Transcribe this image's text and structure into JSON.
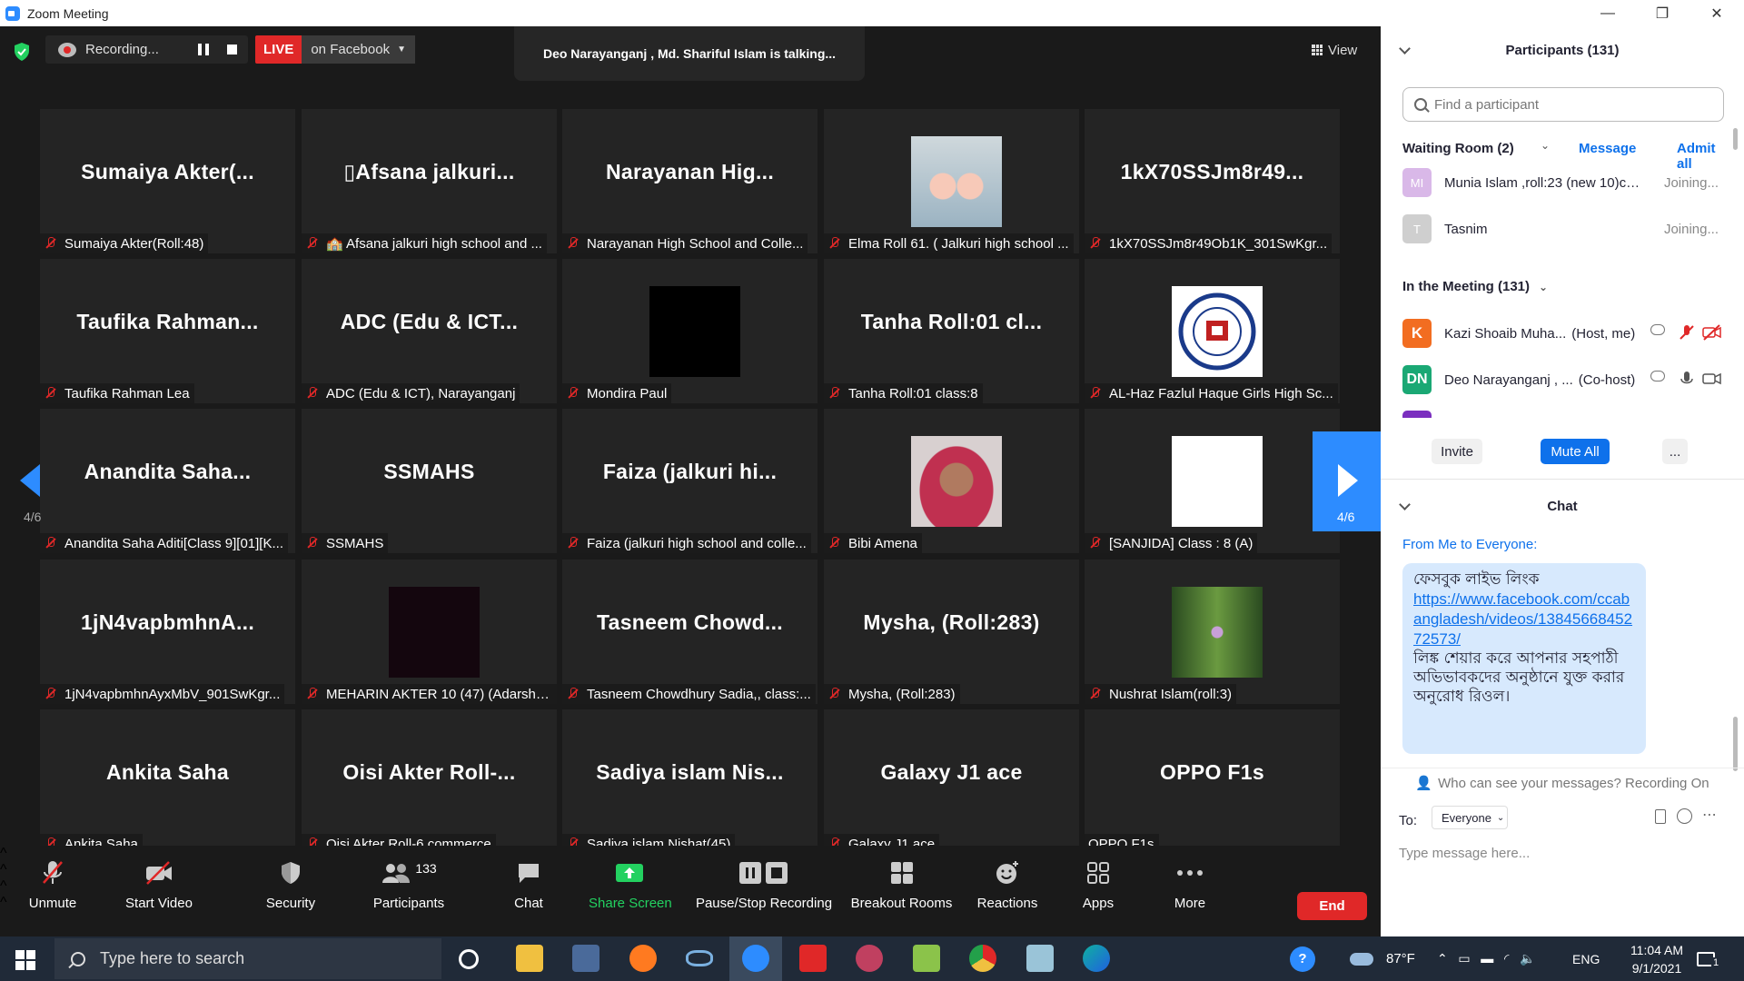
{
  "window": {
    "title": "Zoom Meeting",
    "minimize": "—",
    "maximize": "❐",
    "close": "✕"
  },
  "top": {
    "recording_label": "Recording...",
    "live_label": "LIVE",
    "live_target": "on Facebook",
    "talking": "Deo Narayanganj , Md. Shariful Islam is talking...",
    "view_label": "View"
  },
  "tiles": [
    {
      "big": "Sumaiya  Akter(...",
      "caption": "Sumaiya Akter(Roll:48)",
      "muted": true
    },
    {
      "big": "▯Afsana  jalkuri...",
      "caption": "🏫 Afsana jalkuri high school and ...",
      "muted": true
    },
    {
      "big": "Narayanan  Hig...",
      "caption": "Narayanan High School and Colle...",
      "muted": true
    },
    {
      "big": "",
      "caption": "Elma Roll 61. ( Jalkuri high school ...",
      "muted": true,
      "thumb": "feet"
    },
    {
      "big": "1kX70SSJm8r49...",
      "caption": "1kX70SSJm8r49Ob1K_301SwKgr...",
      "muted": true
    },
    {
      "big": "Taufika  Rahman...",
      "caption": "Taufika Rahman Lea",
      "muted": true
    },
    {
      "big": "ADC  (Edu  &  ICT...",
      "caption": "ADC (Edu & ICT), Narayanganj",
      "muted": true
    },
    {
      "big": "",
      "caption": "Mondira Paul",
      "muted": true,
      "thumb": "black"
    },
    {
      "big": "Tanha  Roll:01  cl...",
      "caption": "Tanha Roll:01 class:8",
      "muted": true
    },
    {
      "big": "",
      "caption": "AL-Haz Fazlul Haque Girls High Sc...",
      "muted": true,
      "thumb": "logo"
    },
    {
      "big": "Anandita  Saha...",
      "caption": "Anandita Saha Aditi[Class 9][01][K...",
      "muted": true
    },
    {
      "big": "SSMAHS",
      "caption": "SSMAHS",
      "muted": true
    },
    {
      "big": "Faiza  (jalkuri  hi...",
      "caption": "Faiza (jalkuri high school and colle...",
      "muted": true
    },
    {
      "big": "",
      "caption": "Bibi Amena",
      "muted": true,
      "thumb": "person"
    },
    {
      "big": "",
      "caption": "[SANJIDA] Class : 8 (A)",
      "muted": true,
      "thumb": "white"
    },
    {
      "big": "1jN4vapbmhnA...",
      "caption": "1jN4vapbmhnAyxMbV_901SwKgr...",
      "muted": true
    },
    {
      "big": "",
      "caption": "MEHARIN AKTER 10 (47) (Adarsha...",
      "muted": true,
      "thumb": "dark"
    },
    {
      "big": "Tasneem  Chowd...",
      "caption": "Tasneem Chowdhury Sadia,, class:...",
      "muted": true
    },
    {
      "big": "Mysha,  (Roll:283)",
      "caption": "Mysha, (Roll:283)",
      "muted": true
    },
    {
      "big": "",
      "caption": "Nushrat Islam(roll:3)",
      "muted": true,
      "thumb": "plant"
    },
    {
      "big": "Ankita  Saha",
      "caption": "Ankita Saha",
      "muted": true
    },
    {
      "big": "Oisi  Akter   Roll-...",
      "caption": "Oisi Akter  Roll-6 commerce",
      "muted": true
    },
    {
      "big": "Sadiya  islam  Nis...",
      "caption": "Sadiya islam Nishat(45)",
      "muted": true
    },
    {
      "big": "Galaxy  J1  ace",
      "caption": "Galaxy J1 ace",
      "muted": true
    },
    {
      "big": "OPPO  F1s",
      "caption": "OPPO F1s",
      "muted": false
    }
  ],
  "pager": {
    "left": "4/6",
    "right": "4/6"
  },
  "toolbar": {
    "unmute": "Unmute",
    "start_video": "Start Video",
    "security": "Security",
    "participants": "Participants",
    "participants_count": "133",
    "chat": "Chat",
    "share_screen": "Share Screen",
    "pause_stop_recording": "Pause/Stop Recording",
    "breakout_rooms": "Breakout Rooms",
    "reactions": "Reactions",
    "apps": "Apps",
    "more": "More",
    "end": "End"
  },
  "panel": {
    "participants_title": "Participants (131)",
    "search_placeholder": "Find a participant",
    "waiting_room": "Waiting Room (2)",
    "message": "Message",
    "admit_all": "Admit all",
    "waiting": [
      {
        "initials": "MI",
        "name": "Munia Islam ,roll:23 (new 10)co...",
        "status": "Joining...",
        "color": "#d9b8e8"
      },
      {
        "initials": "T",
        "name": "Tasnim",
        "status": "Joining...",
        "color": "#cfcfcf"
      }
    ],
    "in_meeting": "In the Meeting (131)",
    "members": [
      {
        "initials": "K",
        "name": "Kazi Shoaib Muha...",
        "role": "(Host, me)",
        "color": "#f26d21"
      },
      {
        "initials": "DN",
        "name": "Deo Narayanganj , ...",
        "role": "(Co-host)",
        "color": "#1aa874"
      }
    ],
    "invite": "Invite",
    "mute_all": "Mute All",
    "more_btn": "...",
    "chat_title": "Chat",
    "chat_from": "From Me to",
    "chat_to": "Everyone:",
    "msg_line1": "ফেসবুক লাইভ লিংক",
    "msg_link": "https://www.facebook.com/ccabangladesh/videos/1384566845272573/",
    "msg_line2": "লিঙ্ক শেয়ার করে আপনার সহপাঠী অভিভাবকদের অনুষ্ঠানে যুক্ত করার অনুরোধ রিওল।",
    "who_can_see": "Who can see your messages? Recording On",
    "to_label": "To:",
    "everyone": "Everyone",
    "type_placeholder": "Type message here..."
  },
  "taskbar": {
    "search": "Type here to search",
    "temp": "87°F",
    "lang": "ENG",
    "time": "11:04 AM",
    "date": "9/1/2021",
    "notif": "1"
  }
}
